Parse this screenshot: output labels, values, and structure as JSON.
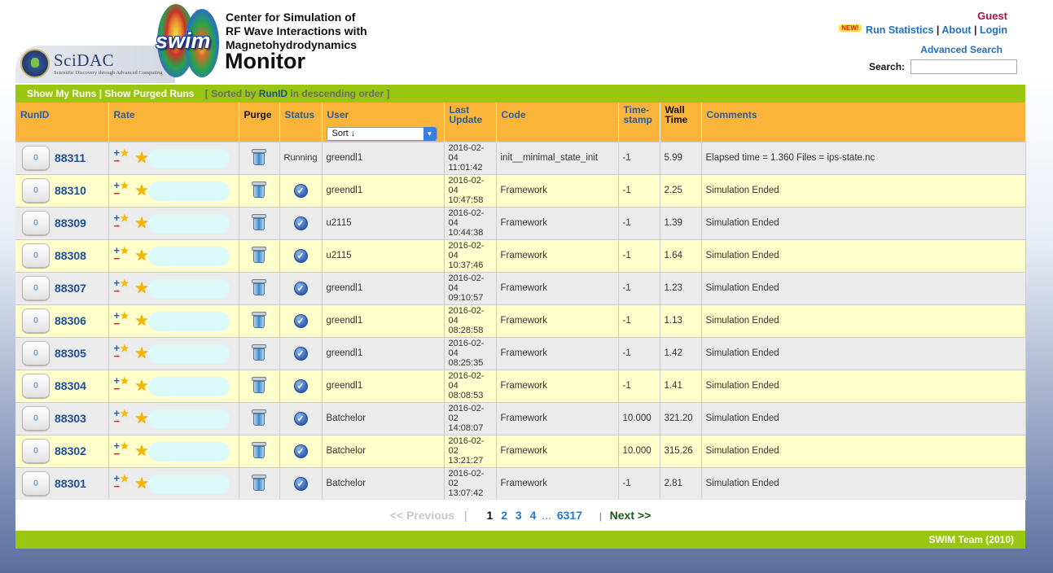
{
  "header": {
    "scidac_name": "SciDAC",
    "scidac_tagline": "Scientific Discovery through Advanced Computing",
    "swim_word": "swim",
    "title_lines": [
      "Center for Simulation of",
      "RF Wave Interactions with",
      "Magnetohydrodynamics"
    ],
    "monitor": "Monitor",
    "guest": "Guest",
    "new_badge": "NEW!",
    "run_statistics": "Run Statistics",
    "about": "About",
    "login": "Login",
    "advanced_search": "Advanced Search",
    "search_label": "Search:",
    "search_value": ""
  },
  "topbar": {
    "show_my_runs": "Show My Runs",
    "show_purged_runs": "Show Purged Runs",
    "sorted_prefix": "[ Sorted by",
    "sorted_key": "RunID",
    "sorted_suffix": "in descending order ]"
  },
  "table": {
    "headers": {
      "runid": "RunID",
      "rate": "Rate",
      "purge": "Purge",
      "status": "Status",
      "user": "User",
      "last_update": "Last Update",
      "code": "Code",
      "timestamp": "Time-stamp",
      "wall_time": "Wall Time",
      "comments": "Comments"
    },
    "sort_select": "Sort ↓",
    "rows": [
      {
        "count": "0",
        "runid": "88311",
        "status": "Running",
        "user": "greendl1",
        "date": "2016-02-04",
        "time": "11:01:42",
        "code": "init__minimal_state_init",
        "timestamp": "-1",
        "wall": "5.99",
        "comment": "Elapsed time = 1.360 Files = ips-state.nc"
      },
      {
        "count": "0",
        "runid": "88310",
        "status": "check",
        "user": "greendl1",
        "date": "2016-02-04",
        "time": "10:47:58",
        "code": "Framework",
        "timestamp": "-1",
        "wall": "2.25",
        "comment": "Simulation Ended"
      },
      {
        "count": "0",
        "runid": "88309",
        "status": "check",
        "user": "u2115",
        "date": "2016-02-04",
        "time": "10:44:38",
        "code": "Framework",
        "timestamp": "-1",
        "wall": "1.39",
        "comment": "Simulation Ended"
      },
      {
        "count": "0",
        "runid": "88308",
        "status": "check",
        "user": "u2115",
        "date": "2016-02-04",
        "time": "10:37:46",
        "code": "Framework",
        "timestamp": "-1",
        "wall": "1.64",
        "comment": "Simulation Ended"
      },
      {
        "count": "0",
        "runid": "88307",
        "status": "check",
        "user": "greendl1",
        "date": "2016-02-04",
        "time": "09:10:57",
        "code": "Framework",
        "timestamp": "-1",
        "wall": "1.23",
        "comment": "Simulation Ended"
      },
      {
        "count": "0",
        "runid": "88306",
        "status": "check",
        "user": "greendl1",
        "date": "2016-02-04",
        "time": "08:28:58",
        "code": "Framework",
        "timestamp": "-1",
        "wall": "1.13",
        "comment": "Simulation Ended"
      },
      {
        "count": "0",
        "runid": "88305",
        "status": "check",
        "user": "greendl1",
        "date": "2016-02-04",
        "time": "08:25:35",
        "code": "Framework",
        "timestamp": "-1",
        "wall": "1.42",
        "comment": "Simulation Ended"
      },
      {
        "count": "0",
        "runid": "88304",
        "status": "check",
        "user": "greendl1",
        "date": "2016-02-04",
        "time": "08:08:53",
        "code": "Framework",
        "timestamp": "-1",
        "wall": "1.41",
        "comment": "Simulation Ended"
      },
      {
        "count": "0",
        "runid": "88303",
        "status": "check",
        "user": "Batchelor",
        "date": "2016-02-02",
        "time": "14:08:07",
        "code": "Framework",
        "timestamp": "10.000",
        "wall": "321.20",
        "comment": "Simulation Ended"
      },
      {
        "count": "0",
        "runid": "88302",
        "status": "check",
        "user": "Batchelor",
        "date": "2016-02-02",
        "time": "13:21:27",
        "code": "Framework",
        "timestamp": "10.000",
        "wall": "315.26",
        "comment": "Simulation Ended"
      },
      {
        "count": "0",
        "runid": "88301",
        "status": "check",
        "user": "Batchelor",
        "date": "2016-02-02",
        "time": "13:07:42",
        "code": "Framework",
        "timestamp": "-1",
        "wall": "2.81",
        "comment": "Simulation Ended"
      }
    ]
  },
  "pager": {
    "previous": "<< Previous",
    "sep": "|",
    "current": "1",
    "pages": [
      "2",
      "3",
      "4"
    ],
    "dots": "...",
    "last": "6317",
    "bar": "|",
    "next": "Next >>"
  },
  "footer": {
    "text": "SWIM Team (2010)"
  },
  "colors": {
    "green_bar": "#99c610",
    "header_orange": "#fbb43a",
    "link_blue": "#1f6fc2",
    "guest": "#b0104a",
    "row_odd": "#ebebeb",
    "row_even": "#ffffcc"
  },
  "icons": {
    "purge": "trash-icon",
    "status_done": "checkmark-icon",
    "rate_toggle": "plus-minus-star-icon",
    "rate_star": "star-icon"
  }
}
